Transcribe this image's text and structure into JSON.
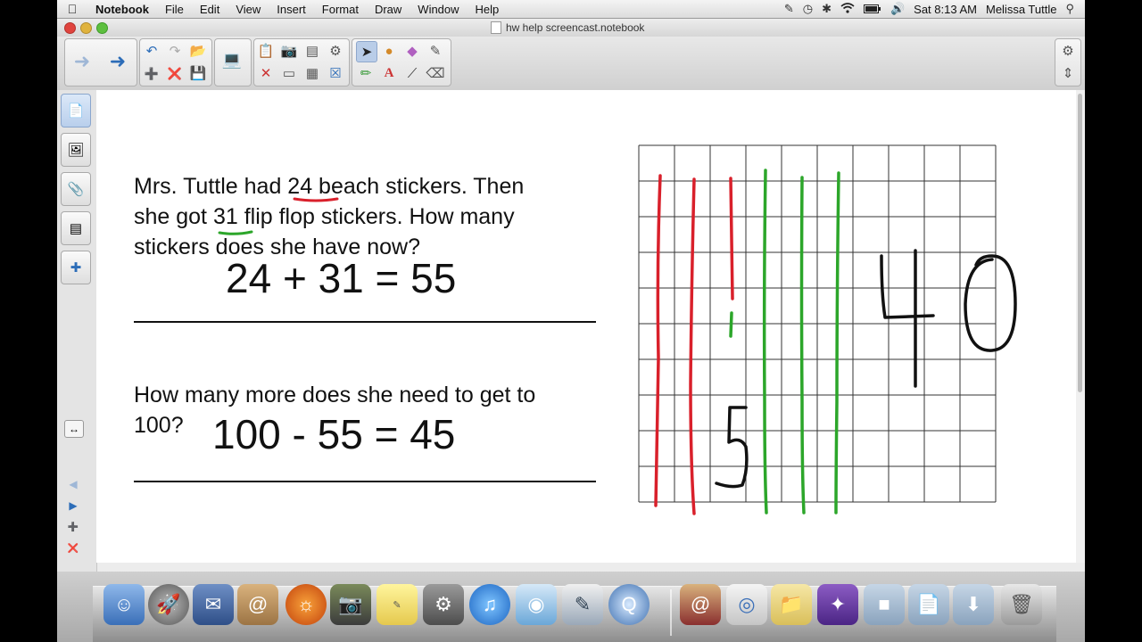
{
  "menubar": {
    "apple_icon": "apple-logo-icon",
    "app_name": "Notebook",
    "menus": [
      "File",
      "Edit",
      "View",
      "Insert",
      "Format",
      "Draw",
      "Window",
      "Help"
    ],
    "clock": "Sat 8:13 AM",
    "user": "Melissa Tuttle",
    "status_icons": [
      "script-icon",
      "time-machine-icon",
      "bluetooth-icon",
      "wifi-icon",
      "battery-icon",
      "volume-icon",
      "spotlight-icon"
    ]
  },
  "window": {
    "title": "hw help screencast.notebook"
  },
  "toolbar": {
    "icons": [
      "back-arrow-icon",
      "forward-arrow-icon",
      "undo-icon",
      "redo-icon",
      "open-folder-icon",
      "add-page-icon",
      "delete-page-icon",
      "save-icon",
      "screen-shade-icon",
      "paste-icon",
      "screen-capture-icon",
      "delete-icon",
      "table-icon",
      "record-icon",
      "close-icon",
      "select-arrow-icon",
      "shapes-icon",
      "eraser-icon",
      "magic-pen-icon",
      "pens-icon",
      "text-icon",
      "line-icon",
      "fill-eraser-icon",
      "gear-icon",
      "sidebar-toggle-icon"
    ]
  },
  "sidebar": {
    "tabs": [
      "page-sorter-icon",
      "gallery-icon",
      "attachments-icon",
      "properties-icon",
      "addons-icon"
    ],
    "extras": [
      "swap-sides-icon",
      "prev-page-icon",
      "next-page-icon",
      "add-page-small-icon",
      "delete-page-small-icon"
    ]
  },
  "canvas": {
    "problem1_line1_pre": "Mrs. Tuttle had ",
    "problem1_num1": "24",
    "problem1_line1_post": " beach stickers.  Then",
    "problem1_line2_pre": "she got ",
    "problem1_num2": "31",
    "problem1_line2_post": " flip flop stickers. How many",
    "problem1_line3": "stickers does she have now?",
    "equation1": "24 + 31 = 55",
    "problem2_line1": "How many more does she need to get to",
    "problem2_line2": "100?",
    "equation2": "100 - 55 = 45",
    "hundred_grid": {
      "rows": 10,
      "cols": 10,
      "red_tens": 3,
      "red_partial_ones": 1,
      "green_tens": 3,
      "handwritten_labels": [
        "5",
        "40"
      ]
    }
  },
  "dock": {
    "apps": [
      "finder-icon",
      "launchpad-icon",
      "mail-icon",
      "address-book-icon",
      "firefox-icon",
      "iphoto-icon",
      "stickies-icon",
      "system-preferences-icon",
      "itunes-icon",
      "dvd-player-icon",
      "textedit-icon",
      "quicktime-icon",
      "contacts-icon",
      "preview-icon",
      "folder-icon",
      "smart-notebook-icon",
      "applications-folder-icon",
      "documents-folder-icon",
      "downloads-folder-icon",
      "trash-icon"
    ]
  },
  "colors": {
    "red_ink": "#d9202b",
    "green_ink": "#2ca62a",
    "black_ink": "#111111",
    "selected_tool": "#b9cde8"
  }
}
